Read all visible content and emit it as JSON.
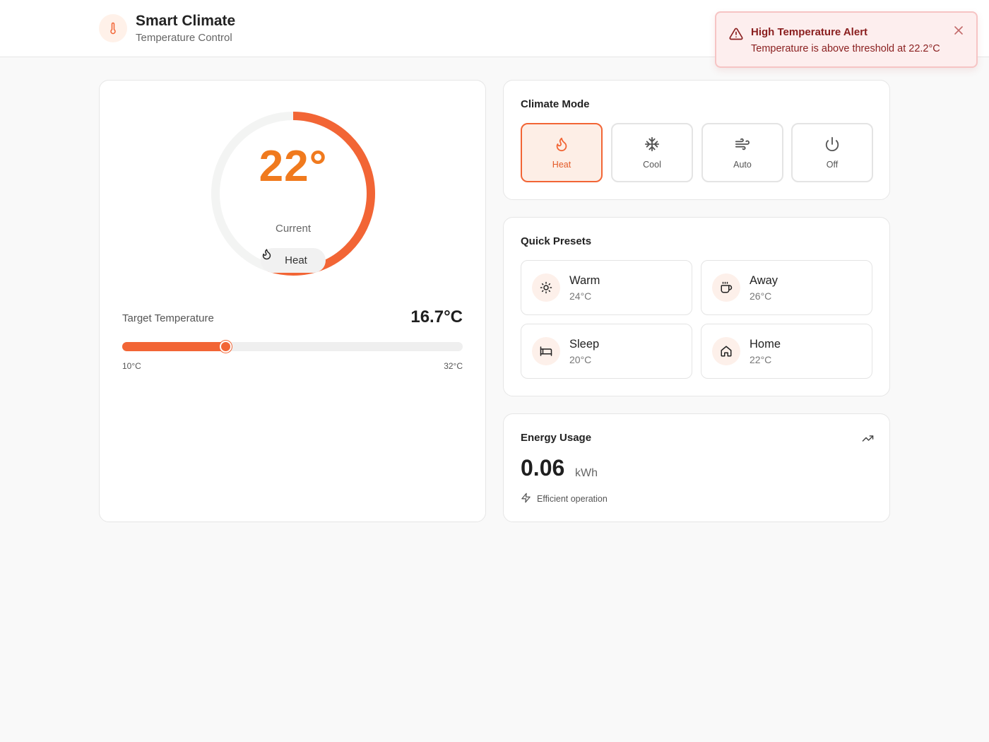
{
  "header": {
    "title": "Smart Climate",
    "subtitle": "Temperature Control",
    "icon": "thermometer-icon"
  },
  "alert": {
    "title": "High Temperature Alert",
    "message": "Temperature is above threshold at 22.2°C",
    "icon": "alert-triangle-icon"
  },
  "dial": {
    "current": "22°",
    "current_label": "Current",
    "mode_label": "Heat",
    "progress_fraction": 0.55
  },
  "target": {
    "label": "Target Temperature",
    "value_text": "16.7°C",
    "value": 16.7,
    "min": 10,
    "max": 32,
    "min_label": "10°C",
    "max_label": "32°C"
  },
  "modes": {
    "title": "Climate Mode",
    "selected": "Heat",
    "items": [
      {
        "label": "Heat",
        "icon": "flame-icon"
      },
      {
        "label": "Cool",
        "icon": "snowflake-icon"
      },
      {
        "label": "Auto",
        "icon": "wind-icon"
      },
      {
        "label": "Off",
        "icon": "power-icon"
      }
    ]
  },
  "presets": {
    "title": "Quick Presets",
    "items": [
      {
        "name": "Warm",
        "temp": "24°C",
        "icon": "sun-icon"
      },
      {
        "name": "Away",
        "temp": "26°C",
        "icon": "coffee-icon"
      },
      {
        "name": "Sleep",
        "temp": "20°C",
        "icon": "bed-icon"
      },
      {
        "name": "Home",
        "temp": "22°C",
        "icon": "home-icon"
      }
    ]
  },
  "energy": {
    "title": "Energy Usage",
    "value": "0.06",
    "unit": "kWh",
    "note": "Efficient operation"
  },
  "colors": {
    "accent": "#f26535",
    "temp_text": "#f07a1e",
    "alert_bg": "#fdeeee",
    "alert_text": "#8a1f1f"
  }
}
